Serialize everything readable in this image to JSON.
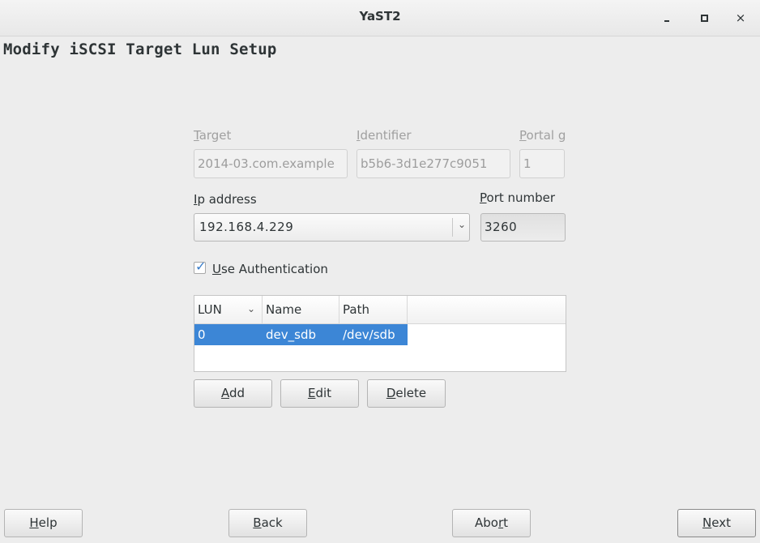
{
  "window": {
    "title": "YaST2",
    "controls": [
      "minimize-icon",
      "maximize-icon",
      "close-icon"
    ],
    "close_glyph": "×"
  },
  "page": {
    "title": "Modify iSCSI Target Lun Setup"
  },
  "target": {
    "label_first": "T",
    "label_rest": "arget",
    "value": "2014-03.com.example"
  },
  "identifier": {
    "label_first": "I",
    "label_rest": "dentifier",
    "value": "b5b6-3d1e277c9051"
  },
  "portal": {
    "label_first": "P",
    "label_rest": "ortal g",
    "value": "1"
  },
  "ip": {
    "label_first": "I",
    "label_rest": "p address",
    "value": "192.168.4.229"
  },
  "port": {
    "label_first": "P",
    "label_rest": "ort number",
    "value": "3260"
  },
  "auth": {
    "label_first": "U",
    "label_rest": "se Authentication",
    "checked": true
  },
  "lun_table": {
    "columns": [
      "LUN",
      "Name",
      "Path"
    ],
    "rows": [
      {
        "lun": "0",
        "name": "dev_sdb",
        "path": "/dev/sdb",
        "selected": true
      }
    ],
    "selection_color": "#3c86d6"
  },
  "table_buttons": {
    "add_first": "A",
    "add_rest": "dd",
    "edit_first": "E",
    "edit_rest": "dit",
    "delete_first": "D",
    "delete_rest": "elete"
  },
  "footer": {
    "help_first": "H",
    "help_rest": "elp",
    "back_first": "B",
    "back_rest": "ack",
    "abort_first": "Abo",
    "abort_u": "r",
    "abort_rest": "t",
    "next_first": "N",
    "next_rest": "ext"
  }
}
